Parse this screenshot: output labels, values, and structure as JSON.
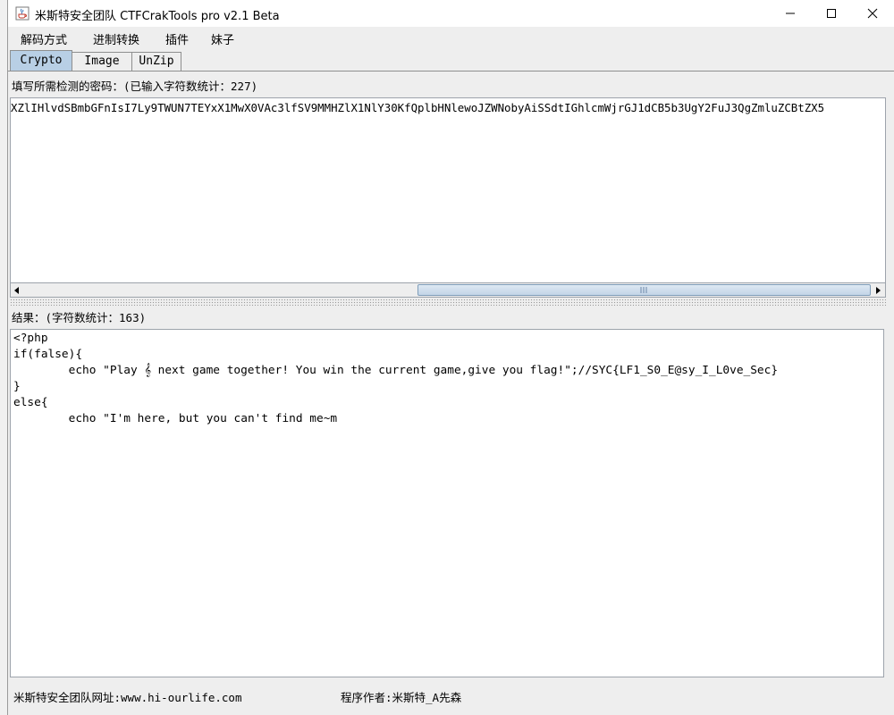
{
  "window": {
    "title": "米斯特安全团队 CTFCrakTools pro v2.1 Beta",
    "minimize_icon": "minimize-icon",
    "maximize_icon": "maximize-icon",
    "close_icon": "close-icon"
  },
  "menu": {
    "items": [
      "解码方式",
      "进制转换",
      "插件",
      "妹子"
    ]
  },
  "tabs": [
    {
      "label": "Crypto",
      "active": true
    },
    {
      "label": "Image",
      "active": false
    },
    {
      "label": "UnZip",
      "active": false
    }
  ],
  "input": {
    "label": "填写所需检测的密码：(已输入字符数统计：227)",
    "value": "XZlIHlvdSBmbGFnIsI7Ly9TWUN7TEYxX1MwX0VAc3lfSV9MMHZlX1NlY30KfQplbHNlewoJZWNobyAiSSdtIGhlcmWjrGJ1dCB5b3UgY2FuJ3QgZmluZCBtZX5"
  },
  "output": {
    "label": "结果：(字符数统计：163)",
    "lines": [
      "<?php",
      "if(false){",
      "        echo \"Play 𝄞 next game together! You win the current game,give you flag!\";//SYC{LF1_S0_E@sy_I_L0ve_Sec}",
      "}",
      "else{",
      "        echo \"I'm here, but you can't find me~m"
    ]
  },
  "status": {
    "website": "米斯特安全团队网址:www.hi-ourlife.com",
    "author": "程序作者:米斯特_A先森"
  },
  "colors": {
    "active_tab": "#b8cfe5",
    "panel_bg": "#eeeeee",
    "scroll_thumb": "#c3d5e8"
  }
}
